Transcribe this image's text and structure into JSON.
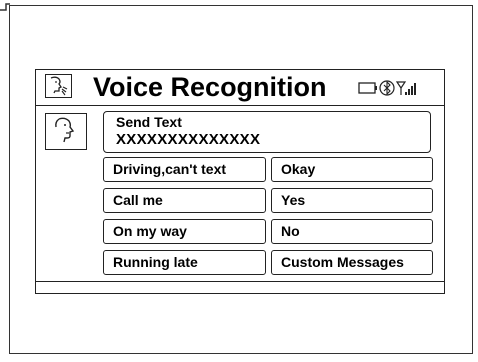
{
  "header": {
    "title": "Voice Recognition",
    "app_icon": "voice-talk-icon",
    "status_icons": [
      "phone-icon",
      "bluetooth-icon",
      "signal-strength-icon"
    ]
  },
  "contact_icon": "talking-head-icon",
  "send_text": {
    "title": "Send Text",
    "recipient": "XXXXXXXXXXXXXX"
  },
  "messages": [
    {
      "label": "Driving,can't text"
    },
    {
      "label": "Okay"
    },
    {
      "label": "Call me"
    },
    {
      "label": "Yes"
    },
    {
      "label": "On my way"
    },
    {
      "label": "No"
    },
    {
      "label": "Running late"
    },
    {
      "label": "Custom Messages"
    }
  ]
}
